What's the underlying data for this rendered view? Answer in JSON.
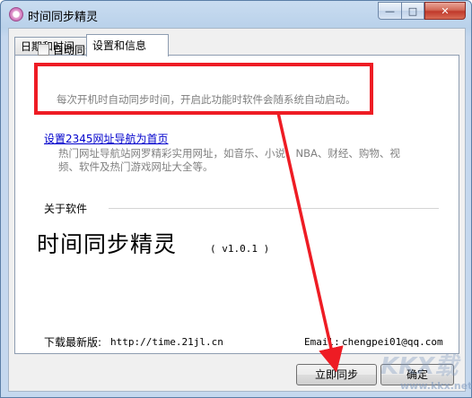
{
  "window": {
    "title": "时间同步精灵",
    "controls": {
      "minimize": "—",
      "maximize": "□",
      "close": "✕"
    }
  },
  "tabs": [
    {
      "label": "日期和时间",
      "selected": false
    },
    {
      "label": "设置和信息",
      "selected": true
    }
  ],
  "settings": {
    "auto_sync_label": "自动同步时间",
    "auto_sync_checked": false,
    "auto_sync_desc": "每次开机时自动同步时间，开启此功能时软件会随系统自动启动。",
    "homepage_link": "设置2345网址导航为首页",
    "homepage_desc_line1": "热门网址导航站网罗精彩实用网址，如音乐、小说、NBA、财经、购物、视",
    "homepage_desc_line2": "频、软件及热门游戏网址大全等。"
  },
  "about": {
    "section_label": "关于软件",
    "app_name": "时间同步精灵",
    "version": "( v1.0.1 )",
    "download_label": "下载最新版:",
    "download_url": "http://time.21jl.cn",
    "email_label": "Email:",
    "email": "chengpei01@qq.com"
  },
  "buttons": {
    "sync_now": "立即同步",
    "ok": "确定"
  },
  "watermark": {
    "logo": "KKX载",
    "site": "www.kkx.net"
  },
  "colors": {
    "annotation_red": "#ee1c24",
    "link_blue": "#0000cc"
  }
}
